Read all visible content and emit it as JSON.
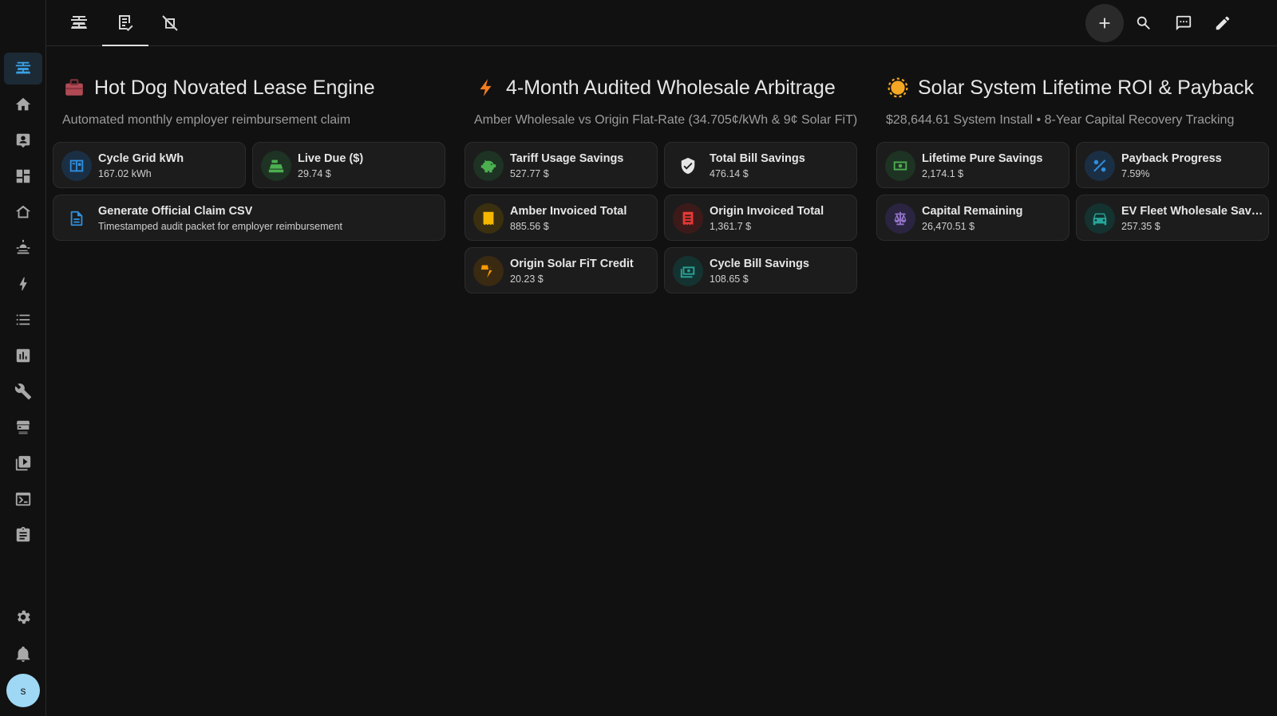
{
  "sidebar": {
    "items": [
      {
        "icon": "solar-panel-icon",
        "active": true
      },
      {
        "icon": "home-icon"
      },
      {
        "icon": "account-box-icon"
      },
      {
        "icon": "dashboard-icon"
      },
      {
        "icon": "home-outline-icon"
      },
      {
        "icon": "weather-icon"
      },
      {
        "icon": "lightning-icon"
      },
      {
        "icon": "list-icon"
      },
      {
        "icon": "chart-icon"
      },
      {
        "icon": "wrench-icon"
      },
      {
        "icon": "hacs-icon"
      },
      {
        "icon": "media-icon"
      },
      {
        "icon": "terminal-icon"
      },
      {
        "icon": "clipboard-icon"
      },
      {
        "icon": "settings-icon"
      },
      {
        "icon": "bell-icon"
      }
    ],
    "avatar_letter": "s"
  },
  "topbar": {
    "tabs": [
      {
        "icon": "solar-panel-icon"
      },
      {
        "icon": "invoice-check-icon",
        "active": true
      },
      {
        "icon": "tag-off-icon"
      }
    ],
    "actions": [
      "add-icon",
      "search-icon",
      "assist-icon",
      "edit-icon"
    ]
  },
  "colors": {
    "background": "#111111",
    "card": "#1c1c1c",
    "accent": "#3aa2e8"
  },
  "sections": [
    {
      "emoji": "briefcase-icon",
      "title": "Hot Dog Novated Lease Engine",
      "subtitle": "Automated monthly employer reimbursement claim",
      "tiles": [
        {
          "name": "Cycle Grid kWh",
          "state": "167.02 kWh",
          "icon": "meter-icon",
          "color": "#2f8fde"
        },
        {
          "name": "Live Due ($)",
          "state": "29.74 $",
          "icon": "cash-register-icon",
          "color": "#4caf50"
        },
        {
          "name": "Generate Official Claim CSV",
          "state": "Timestamped audit packet for employer reimbursement",
          "icon": "file-document-icon",
          "color": "#2f8fde"
        }
      ]
    },
    {
      "emoji": "lightning-bolt-icon",
      "title": "4-Month Audited Wholesale Arbitrage",
      "subtitle": "Amber Wholesale vs Origin Flat-Rate (34.705¢/kWh & 9¢ Solar FiT)",
      "tiles": [
        {
          "name": "Tariff Usage Savings",
          "state": "527.77 $",
          "icon": "piggy-bank-icon",
          "color": "#4caf50"
        },
        {
          "name": "Total Bill Savings",
          "state": "476.14 $",
          "icon": "shield-check-icon",
          "color": "#e6e6e6"
        },
        {
          "name": "Amber Invoiced Total",
          "state": "885.56 $",
          "icon": "receipt-icon",
          "color": "#f5b800"
        },
        {
          "name": "Origin Invoiced Total",
          "state": "1,361.7 $",
          "icon": "receipt-text-icon",
          "color": "#e53935"
        },
        {
          "name": "Origin Solar FiT Credit",
          "state": "20.23 $",
          "icon": "solar-power-icon",
          "color": "#ff9800"
        },
        {
          "name": "Cycle Bill Savings",
          "state": "108.65 $",
          "icon": "cash-multiple-icon",
          "color": "#26a69a"
        }
      ]
    },
    {
      "emoji": "sun-icon",
      "title": "Solar System Lifetime ROI & Payback",
      "subtitle": "$28,644.61 System Install • 8-Year Capital Recovery Tracking",
      "tiles": [
        {
          "name": "Lifetime Pure Savings",
          "state": "2,174.1 $",
          "icon": "cash-icon",
          "color": "#4caf50"
        },
        {
          "name": "Payback Progress",
          "state": "7.59%",
          "icon": "percent-icon",
          "color": "#2f8fde"
        },
        {
          "name": "Capital Remaining",
          "state": "26,470.51 $",
          "icon": "scale-balance-icon",
          "color": "#9575cd"
        },
        {
          "name": "EV Fleet Wholesale Savings",
          "state": "257.35 $",
          "icon": "car-icon",
          "color": "#26a69a"
        }
      ]
    }
  ]
}
